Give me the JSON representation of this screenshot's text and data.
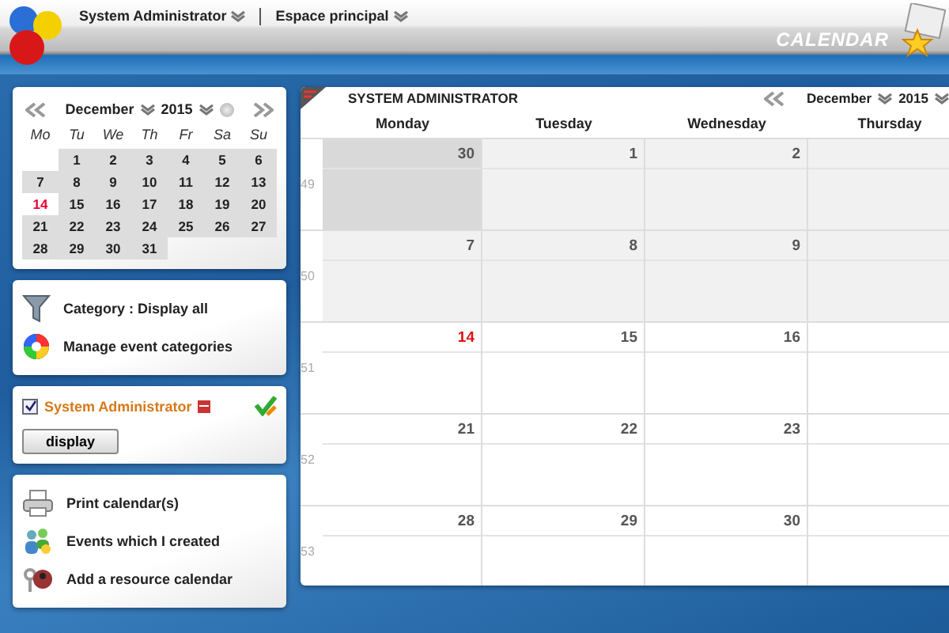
{
  "header": {
    "menus": [
      {
        "label": "System Administrator"
      },
      {
        "label": "Espace principal"
      }
    ],
    "section_title": "CALENDAR"
  },
  "mini_calendar": {
    "month": "December",
    "year": "2015",
    "weekdays": [
      "Mo",
      "Tu",
      "We",
      "Th",
      "Fr",
      "Sa",
      "Su"
    ],
    "weeks": [
      {
        "days": [
          {
            "day": "1",
            "today": false
          },
          {
            "day": "2",
            "today": false
          },
          {
            "day": "3",
            "today": false
          },
          {
            "day": "4",
            "today": false
          },
          {
            "day": "5",
            "today": false
          },
          {
            "day": "6",
            "today": false
          }
        ]
      },
      {
        "days": [
          {
            "day": "7",
            "today": false
          },
          {
            "day": "8",
            "today": false
          },
          {
            "day": "9",
            "today": false
          },
          {
            "day": "10",
            "today": false
          },
          {
            "day": "11",
            "today": false
          },
          {
            "day": "12",
            "today": false
          },
          {
            "day": "13",
            "today": false
          }
        ]
      },
      {
        "days": [
          {
            "day": "14",
            "today": true
          },
          {
            "day": "15",
            "today": false
          },
          {
            "day": "16",
            "today": false
          },
          {
            "day": "17",
            "today": false
          },
          {
            "day": "18",
            "today": false
          },
          {
            "day": "19",
            "today": false
          },
          {
            "day": "20",
            "today": false
          }
        ]
      },
      {
        "days": [
          {
            "day": "21",
            "today": false
          },
          {
            "day": "22",
            "today": false
          },
          {
            "day": "23",
            "today": false
          },
          {
            "day": "24",
            "today": false
          },
          {
            "day": "25",
            "today": false
          },
          {
            "day": "26",
            "today": false
          },
          {
            "day": "27",
            "today": false
          }
        ]
      },
      {
        "days": [
          {
            "day": "28",
            "today": false
          },
          {
            "day": "29",
            "today": false
          },
          {
            "day": "30",
            "today": false
          },
          {
            "day": "31",
            "today": false
          }
        ]
      }
    ]
  },
  "category_panel": {
    "items": [
      {
        "kind": "filter",
        "label": "Category : Display all"
      },
      {
        "kind": "colors",
        "label": "Manage event categories"
      }
    ]
  },
  "calendars_panel": {
    "calendar": {
      "name": "System Administrator",
      "checked": true
    },
    "button": "display"
  },
  "actions_panel": {
    "items": [
      {
        "kind": "printer",
        "label": "Print calendar(s)"
      },
      {
        "kind": "people",
        "label": "Events which I created"
      },
      {
        "kind": "resource",
        "label": "Add a resource calendar"
      }
    ]
  },
  "calendar": {
    "owner": "SYSTEM ADMINISTRATOR",
    "month": "December",
    "year": "2015",
    "columns": [
      "Monday",
      "Tuesday",
      "Wednesday",
      "Thursday"
    ],
    "weeks": [
      {
        "number": "49",
        "days": [
          {
            "day": "30",
            "kind": "outside"
          },
          {
            "day": "1",
            "kind": "past"
          },
          {
            "day": "2",
            "kind": "past"
          },
          {
            "kind": "past"
          }
        ]
      },
      {
        "number": "50",
        "days": [
          {
            "day": "7",
            "kind": "past"
          },
          {
            "day": "8",
            "kind": "past"
          },
          {
            "day": "9",
            "kind": "past"
          },
          {
            "kind": "past"
          }
        ]
      },
      {
        "number": "51",
        "days": [
          {
            "day": "14",
            "kind": "today"
          },
          {
            "day": "15",
            "kind": "future"
          },
          {
            "day": "16",
            "kind": "future"
          },
          {
            "kind": "future"
          }
        ]
      },
      {
        "number": "52",
        "days": [
          {
            "day": "21",
            "kind": "future"
          },
          {
            "day": "22",
            "kind": "future"
          },
          {
            "day": "23",
            "kind": "future"
          },
          {
            "kind": "future"
          }
        ]
      },
      {
        "number": "53",
        "days": [
          {
            "day": "28",
            "kind": "future"
          },
          {
            "day": "29",
            "kind": "future"
          },
          {
            "day": "30",
            "kind": "future"
          },
          {
            "kind": "future"
          }
        ]
      }
    ]
  }
}
